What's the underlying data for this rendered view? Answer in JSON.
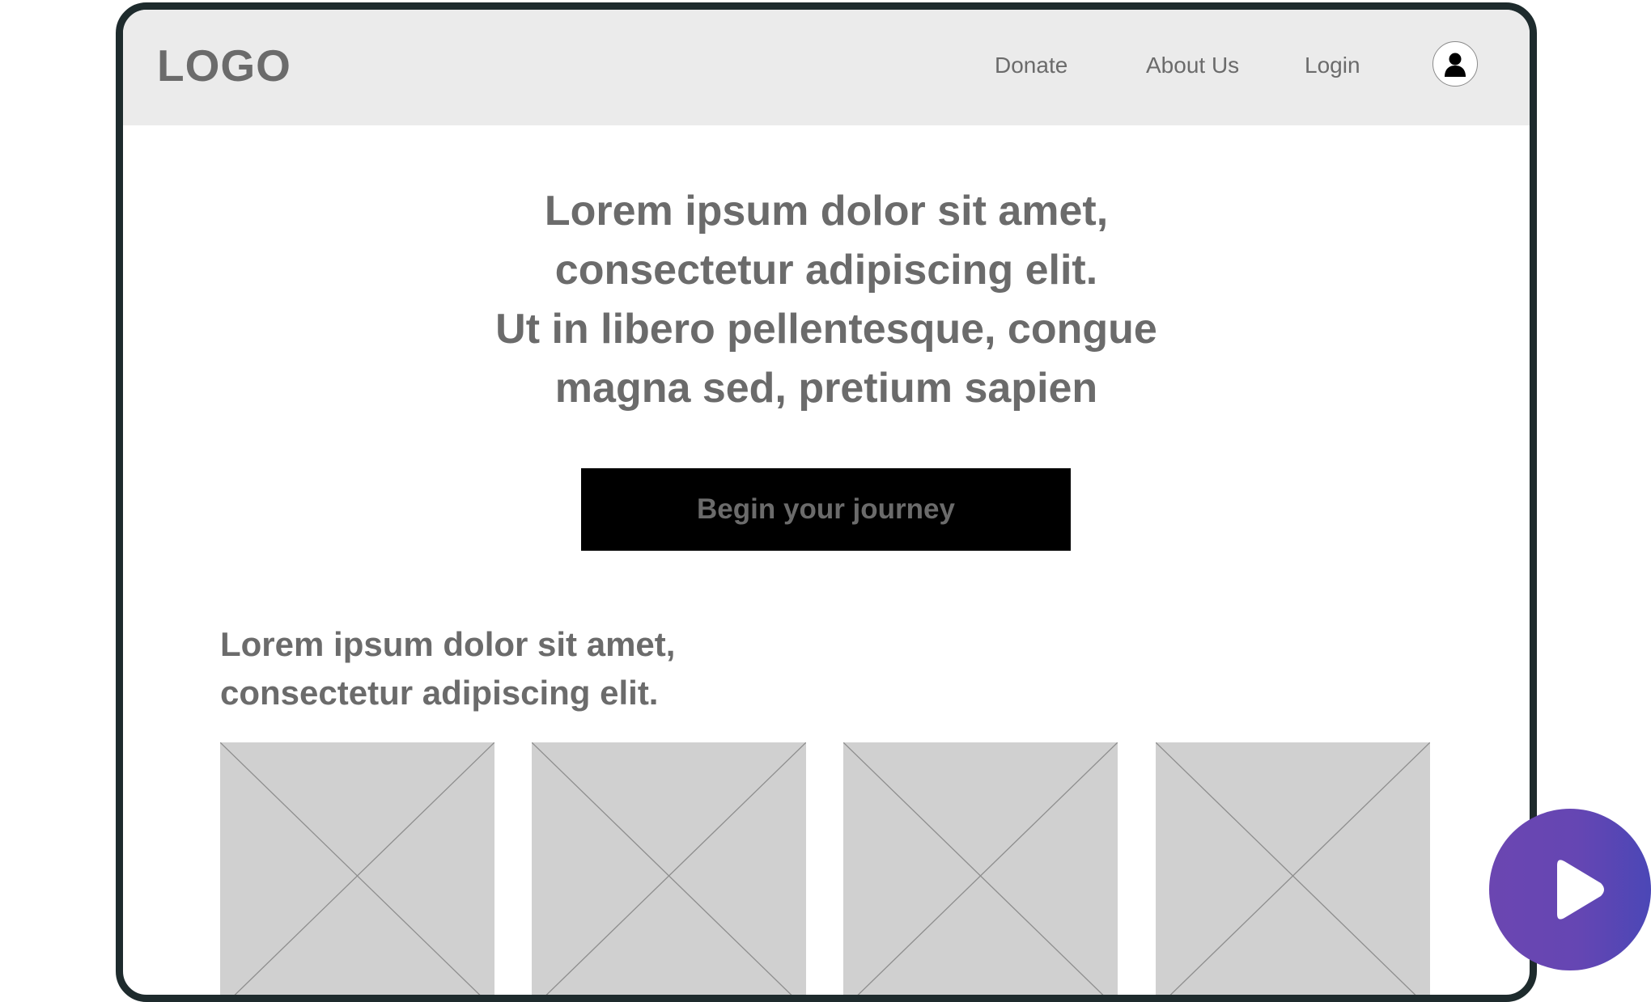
{
  "header": {
    "logo": "LOGO",
    "nav": {
      "donate": "Donate",
      "about": "About Us",
      "login": "Login"
    },
    "avatar_icon": "user-icon"
  },
  "hero": {
    "lines": [
      "Lorem ipsum dolor sit amet,",
      "consectetur adipiscing elit.",
      "Ut in libero pellentesque, congue",
      "magna sed, pretium sapien"
    ],
    "cta_label": "Begin your journey"
  },
  "section": {
    "lines": [
      "Lorem ipsum dolor sit amet,",
      "consectetur adipiscing elit."
    ]
  },
  "image_placeholders": [
    "image-placeholder",
    "image-placeholder",
    "image-placeholder",
    "image-placeholder"
  ],
  "overlay": {
    "play_icon": "play-icon"
  },
  "colors": {
    "frame": "#1e2b2d",
    "navbar_bg": "#ebebeb",
    "text_gray": "#6b6b6b",
    "placeholder_bg": "#d0d0d0",
    "cta_bg": "#000000",
    "play_gradient_start": "#6b46b1",
    "play_gradient_end": "#4b47b6"
  }
}
